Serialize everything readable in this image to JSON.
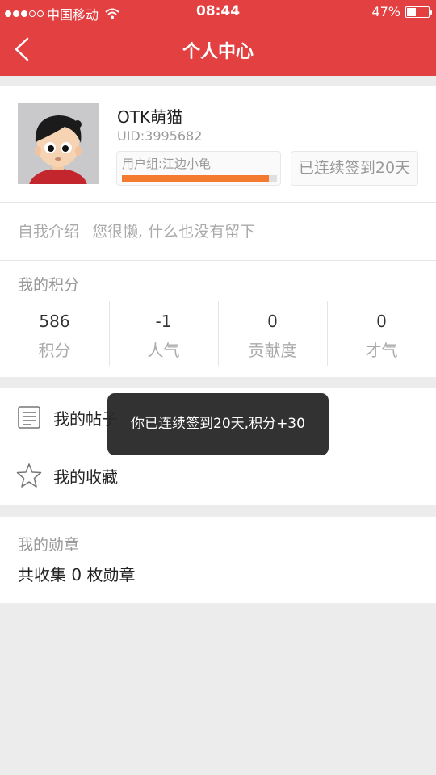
{
  "status_bar": {
    "carrier": "中国移动",
    "time": "08:44",
    "battery_text": "47%",
    "battery_level": 0.47,
    "signal_bars_filled": 3,
    "signal_bars_total": 5
  },
  "nav": {
    "title": "个人中心",
    "back_icon": "chevron-left-icon"
  },
  "profile": {
    "username": "OTK萌猫",
    "uid": "UID:3995682",
    "group_label": "用户组:江边小龟",
    "level_progress": 0.95,
    "checkin_text": "已连续签到20天",
    "intro_label": "自我介绍",
    "intro_text": "您很懒, 什么也没有留下"
  },
  "points": {
    "title": "我的积分",
    "stats": [
      {
        "value": "586",
        "label": "积分"
      },
      {
        "value": "-1",
        "label": "人气"
      },
      {
        "value": "0",
        "label": "贡献度"
      },
      {
        "value": "0",
        "label": "才气"
      }
    ]
  },
  "menu": {
    "posts_label": "我的帖子",
    "posts_icon": "document-icon",
    "favorites_label": "我的收藏",
    "favorites_icon": "star-icon"
  },
  "medals": {
    "title": "我的勋章",
    "count_text": "共收集 0 枚勋章"
  },
  "toast": {
    "text": "你已连续签到20天,积分+30"
  },
  "colors": {
    "brand": "#e34042",
    "progress": "#f37a2e",
    "background": "#ececec"
  }
}
